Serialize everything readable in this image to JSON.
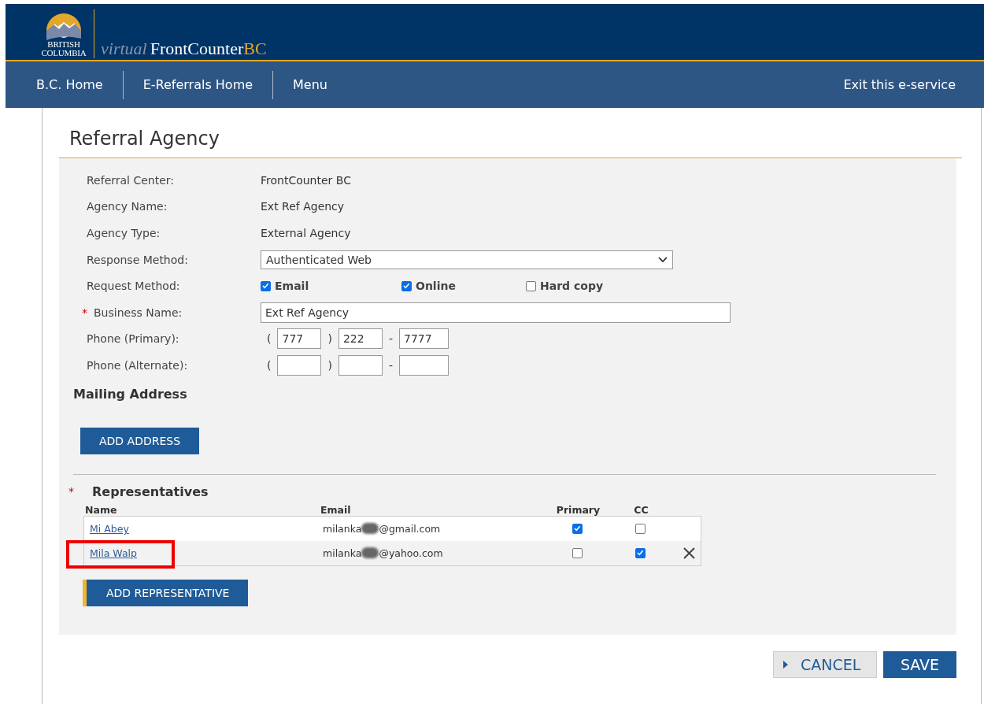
{
  "header": {
    "logo_line1": "BRITISH",
    "logo_line2": "COLUMBIA",
    "brand_italic": "virtual",
    "brand_main": "FrontCounter",
    "brand_suffix": "BC"
  },
  "nav": {
    "items": [
      "B.C. Home",
      "E-Referrals Home",
      "Menu"
    ],
    "exit": "Exit this e-service"
  },
  "page_title": "Referral Agency",
  "required_mark": "*",
  "fields": [
    {
      "kind": "static",
      "label": "Referral Center:",
      "required": false,
      "value": "FrontCounter BC"
    },
    {
      "kind": "static",
      "label": "Agency Name:",
      "required": false,
      "value": "Ext Ref Agency"
    },
    {
      "kind": "static",
      "label": "Agency Type:",
      "required": false,
      "value": "External Agency"
    },
    {
      "kind": "select",
      "label": "Response Method:",
      "required": false,
      "value": "Authenticated Web"
    },
    {
      "kind": "checks",
      "label": "Request Method:",
      "required": false,
      "options": [
        {
          "label": "Email",
          "checked": true
        },
        {
          "label": "Online",
          "checked": true
        },
        {
          "label": "Hard copy",
          "checked": false
        }
      ]
    },
    {
      "kind": "text",
      "label": "Business Name:",
      "required": true,
      "value": "Ext Ref Agency"
    },
    {
      "kind": "phone",
      "label": "Phone (Primary):",
      "required": false,
      "open": "(",
      "close": ")",
      "dash": "-",
      "parts": [
        "777",
        "222",
        "7777"
      ]
    },
    {
      "kind": "phone",
      "label": "Phone (Alternate):",
      "required": false,
      "open": "(",
      "close": ")",
      "dash": "-"
    }
  ],
  "mailing": {
    "heading": "Mailing Address",
    "button": "ADD ADDRESS"
  },
  "representatives": {
    "required": true,
    "heading": "Representatives",
    "columns": [
      "Name",
      "Email",
      "Primary",
      "CC"
    ],
    "rows": [
      {
        "name": "Mi Abey",
        "email_start": "milanka",
        "email_end": "@gmail.com",
        "primary": true,
        "cc": false,
        "removable": false,
        "highlighted": false
      },
      {
        "name": "Mila Walp",
        "email_start": "milanka",
        "email_end": "@yahoo.com",
        "primary": false,
        "cc": true,
        "removable": true,
        "highlighted": true
      }
    ],
    "add_button": "ADD REPRESENTATIVE"
  },
  "actions": {
    "cancel": "CANCEL",
    "save": "SAVE"
  }
}
